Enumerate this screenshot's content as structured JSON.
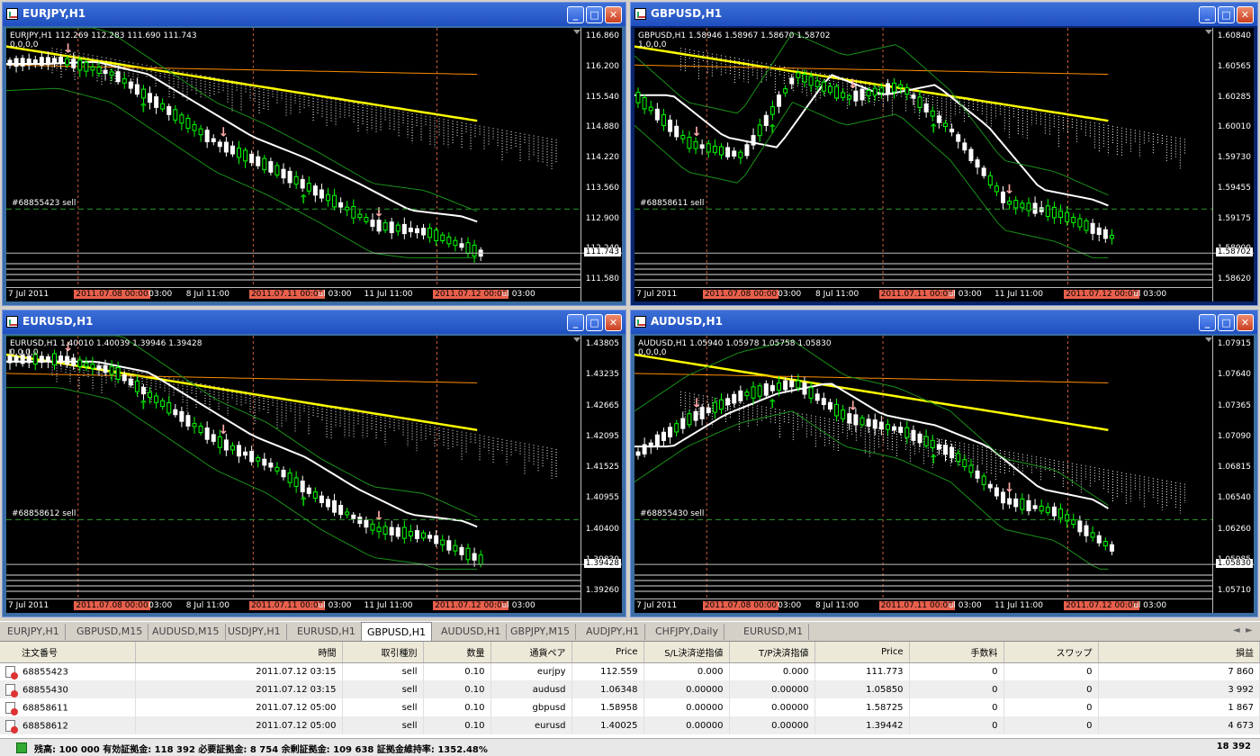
{
  "windows": [
    {
      "title": "EURJPY,H1",
      "header": "EURJPY,H1  112.269 112.283 111.690 111.743",
      "subheader": "0,0,0,0",
      "order_label": "#68855423 sell",
      "prices": [
        "116.860",
        "116.200",
        "115.540",
        "114.880",
        "114.220",
        "113.560",
        "112.900",
        "112.240",
        "111.580"
      ],
      "current_price": "111.743",
      "times": [
        "7 Jul 2011",
        "2011.07.08 00:00",
        "03:00",
        "8 Jul 11:00",
        "2011.07.11 00:00",
        "ul 03:00",
        "11 Jul 11:00",
        "2011.07.12 00:00",
        "ul 03:00"
      ],
      "active": false
    },
    {
      "title": "GBPUSD,H1",
      "header": "GBPUSD,H1  1.58946 1.58967 1.58670 1.58702",
      "subheader": "1,0,0,0",
      "order_label": "#68858611 sell",
      "prices": [
        "1.60840",
        "1.60565",
        "1.60285",
        "1.60010",
        "1.59730",
        "1.59455",
        "1.59175",
        "1.58900",
        "1.58620"
      ],
      "current_price": "1.58702",
      "times": [
        "7 Jul 2011",
        "2011.07.08 00:00",
        "03:00",
        "8 Jul 11:00",
        "2011.07.11 00:00",
        "ul 03:00",
        "11 Jul 11:00",
        "2011.07.12 00:00",
        "ul 03:00"
      ],
      "active": true
    },
    {
      "title": "EURUSD,H1",
      "header": "EURUSD,H1  1.40010 1.40039 1.39946 1.39428",
      "subheader": "0,0,0,0",
      "order_label": "#68858612 sell",
      "prices": [
        "1.43805",
        "1.43235",
        "1.42665",
        "1.42095",
        "1.41525",
        "1.40955",
        "1.40400",
        "1.39830",
        "1.39260"
      ],
      "current_price": "1.39428",
      "times": [
        "7 Jul 2011",
        "2011.07.08 00:00",
        "03:00",
        "8 Jul 11:00",
        "2011.07.11 00:00",
        "ul 03:00",
        "11 Jul 11:00",
        "2011.07.12 00:00",
        "ul 03:00"
      ],
      "active": false
    },
    {
      "title": "AUDUSD,H1",
      "header": "AUDUSD,H1  1.05940 1.05978 1.05758 1.05830",
      "subheader": "0,0,0,0",
      "order_label": "#68855430 sell",
      "prices": [
        "1.07915",
        "1.07640",
        "1.07365",
        "1.07090",
        "1.06815",
        "1.06540",
        "1.06260",
        "1.05985",
        "1.05710"
      ],
      "current_price": "1.05830",
      "times": [
        "7 Jul 2011",
        "2011.07.08 00:00",
        "03:00",
        "8 Jul 11:00",
        "2011.07.11 00:00",
        "ul 03:00",
        "11 Jul 11:00",
        "2011.07.12 00:00",
        "ul 03:00"
      ],
      "active": false
    }
  ],
  "tabs": [
    "EURJPY,H1",
    "GBPUSD,M15",
    "AUDUSD,M15",
    "USDJPY,H1",
    "EURUSD,H1",
    "GBPUSD,H1",
    "AUDUSD,H1",
    "GBPJPY,M15",
    "AUDJPY,H1",
    "CHFJPY,Daily",
    "EURUSD,M1"
  ],
  "active_tab": "GBPUSD,H1",
  "terminal": {
    "columns": [
      "注文番号",
      "時間",
      "取引種別",
      "数量",
      "通貨ペア",
      "Price",
      "S/L決済逆指値",
      "T/P決済指値",
      "Price",
      "手数料",
      "スワップ",
      "損益"
    ],
    "rows": [
      [
        "68855423",
        "2011.07.12 03:15",
        "sell",
        "0.10",
        "eurjpy",
        "112.559",
        "0.000",
        "0.000",
        "111.773",
        "0",
        "0",
        "7 860"
      ],
      [
        "68855430",
        "2011.07.12 03:15",
        "sell",
        "0.10",
        "audusd",
        "1.06348",
        "0.00000",
        "0.00000",
        "1.05850",
        "0",
        "0",
        "3 992"
      ],
      [
        "68858611",
        "2011.07.12 05:00",
        "sell",
        "0.10",
        "gbpusd",
        "1.58958",
        "0.00000",
        "0.00000",
        "1.58725",
        "0",
        "0",
        "1 867"
      ],
      [
        "68858612",
        "2011.07.12 05:00",
        "sell",
        "0.10",
        "eurusd",
        "1.40025",
        "0.00000",
        "0.00000",
        "1.39442",
        "0",
        "0",
        "4 673"
      ]
    ],
    "status": "残高: 100 000  有効証拠金: 118 392  必要証拠金: 8 754  余剰証拠金: 109 638  証拠金維持率: 1352.48%",
    "total": "18 392"
  },
  "colors": {
    "candle_up": "#00ff00",
    "candle_down": "#ffffff",
    "ma_yellow": "#ffff00",
    "ma_white": "#ffffff",
    "ma_orange": "#ff8c00",
    "bands": "#1a8f1a",
    "arrow_down": "#ffaaaa",
    "arrow_up": "#00cc00",
    "time_hl": "#e8604c"
  }
}
